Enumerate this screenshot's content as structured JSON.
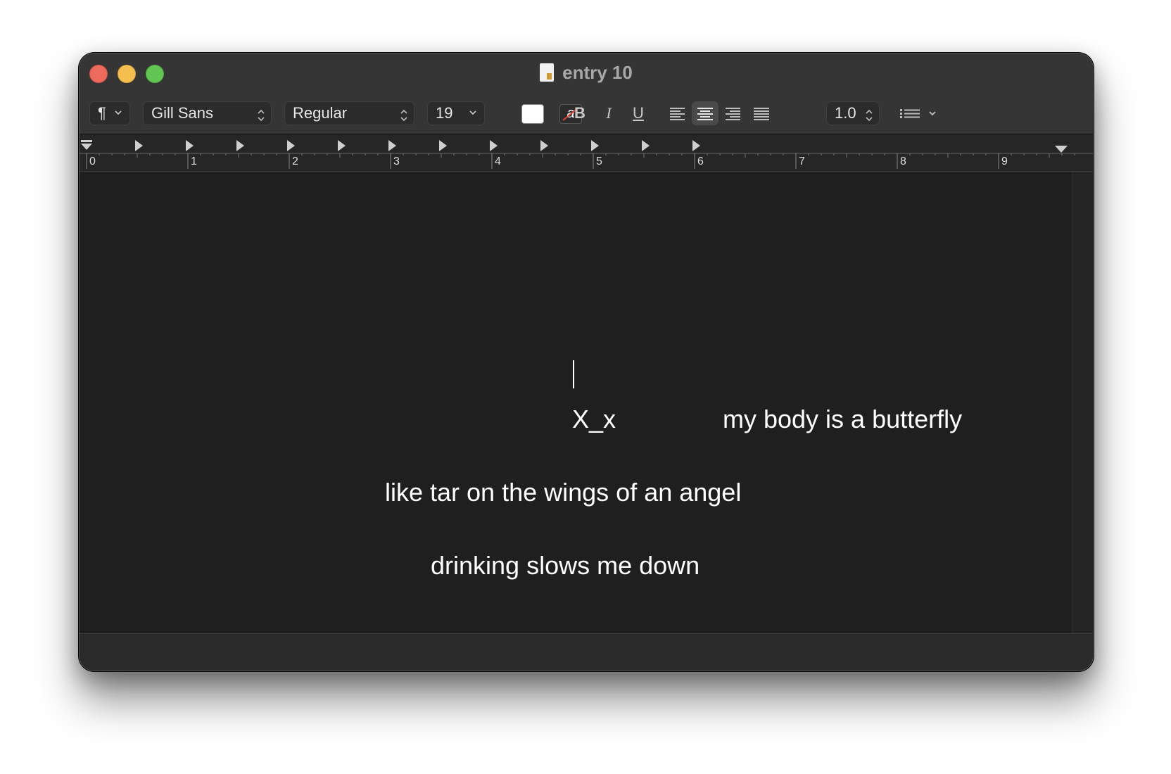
{
  "window": {
    "title": "entry 10"
  },
  "toolbar": {
    "paragraph_symbol": "¶",
    "font_family": "Gill Sans",
    "font_style": "Regular",
    "font_size": "19",
    "text_color": "#ffffff",
    "bgcolor_glyph": "a",
    "bold_label": "B",
    "italic_label": "I",
    "underline_label": "U",
    "alignment_selected": "center",
    "line_spacing": "1.0"
  },
  "ruler": {
    "labels": [
      "0",
      "1",
      "2",
      "3",
      "4",
      "5",
      "6",
      "7",
      "8",
      "9"
    ]
  },
  "document": {
    "line1_left": "X_x",
    "line1_right": "my body is a butterfly",
    "line2": "like tar on the wings of an angel",
    "line3": "drinking slows me down"
  }
}
